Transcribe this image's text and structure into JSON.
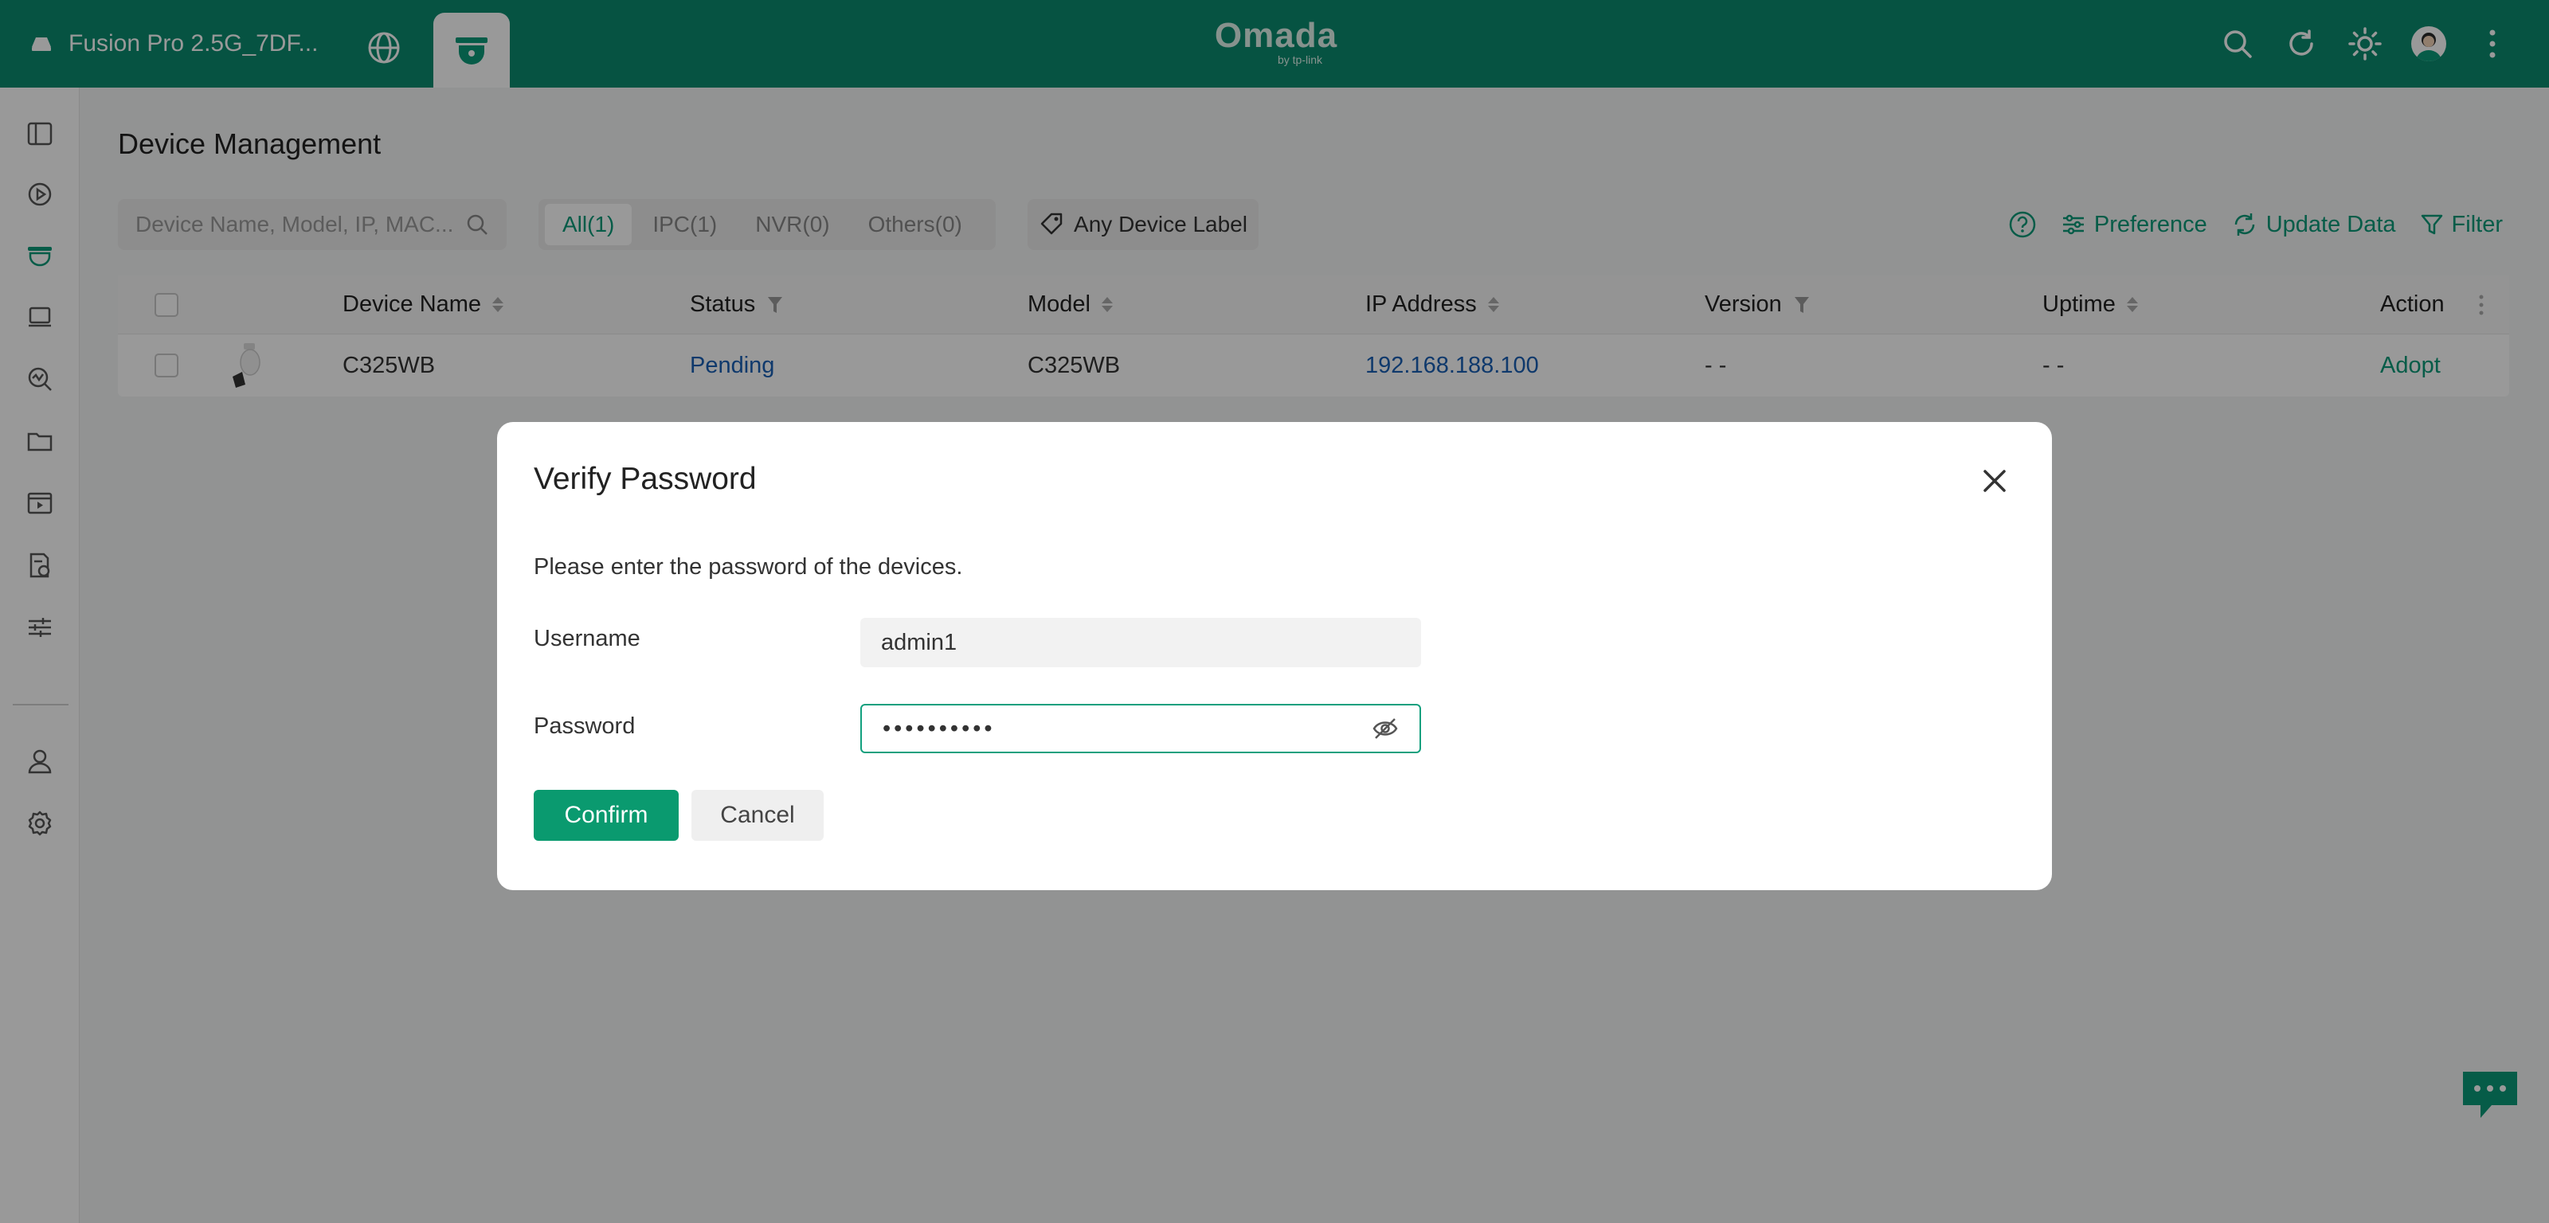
{
  "header": {
    "site_name": "Fusion Pro 2.5G_7DF...",
    "logo_main": "Omada",
    "logo_sub": "by tp-link"
  },
  "icons": {
    "site": "router-icon",
    "globe": "globe-icon",
    "camera_tab": "camera-icon",
    "search": "search-icon",
    "refresh": "refresh-icon",
    "theme": "sun-icon",
    "more": "more-vertical-icon"
  },
  "page": {
    "title": "Device Management",
    "search_placeholder": "Device Name, Model, IP, MAC...",
    "filters": [
      "All(1)",
      "IPC(1)",
      "NVR(0)",
      "Others(0)"
    ],
    "label_filter": "Any Device Label",
    "preference": "Preference",
    "update_data": "Update Data",
    "filter": "Filter"
  },
  "table": {
    "headers": {
      "device_name": "Device Name",
      "status": "Status",
      "model": "Model",
      "ip": "IP Address",
      "version": "Version",
      "uptime": "Uptime",
      "action": "Action"
    },
    "rows": [
      {
        "device_name": "C325WB",
        "status": "Pending",
        "model": "C325WB",
        "ip": "192.168.188.100",
        "version": "- -",
        "uptime": "- -",
        "action": "Adopt"
      }
    ]
  },
  "modal": {
    "title": "Verify Password",
    "description": "Please enter the password of the devices.",
    "username_label": "Username",
    "username_value": "admin1",
    "password_label": "Password",
    "password_value": "••••••••••",
    "confirm": "Confirm",
    "cancel": "Cancel"
  },
  "colors": {
    "brand": "#0a8a6f",
    "accent": "#0a9a78",
    "link": "#1a5fb4"
  }
}
